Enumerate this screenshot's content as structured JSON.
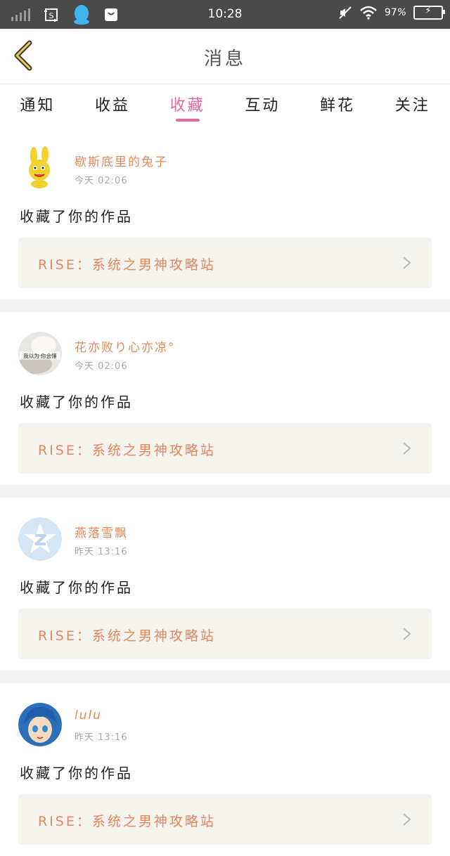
{
  "status_bar": {
    "time": "10:28",
    "battery": "97",
    "icons": [
      "signal-icon",
      "screenshot-icon",
      "qq-icon",
      "shopping-bag-icon",
      "mute-icon",
      "wifi-icon",
      "battery-icon"
    ]
  },
  "header": {
    "title": "消息",
    "back_icon": "chevron-left-icon"
  },
  "tabs": [
    {
      "label": "通知",
      "active": false
    },
    {
      "label": "收益",
      "active": false
    },
    {
      "label": "收藏",
      "active": true
    },
    {
      "label": "互动",
      "active": false
    },
    {
      "label": "鲜花",
      "active": false
    },
    {
      "label": "关注",
      "active": false
    }
  ],
  "colors": {
    "accent_pink": "#e46aa0",
    "name_orange": "#e48a5a",
    "work_bg": "#f4f3ee"
  },
  "messages": [
    {
      "user": "歇斯底里的兔子",
      "time": "今天 02:06",
      "action": "收藏了你的作品",
      "work": "RISE：系统之男神攻略站",
      "avatar": "bunny-avatar"
    },
    {
      "user": "花亦败り心亦凉°",
      "time": "今天 02:06",
      "action": "收藏了你的作品",
      "work": "RISE：系统之男神攻略站",
      "avatar": "photo-avatar",
      "avatar_text": "我以为·你会懂"
    },
    {
      "user": "燕落雪飘",
      "time": "昨天 13:16",
      "action": "收藏了你的作品",
      "work": "RISE：系统之男神攻略站",
      "avatar": "default-qq-avatar"
    },
    {
      "user": "lulu",
      "time": "昨天 13:16",
      "action": "收藏了你的作品",
      "work": "RISE：系统之男神攻略站",
      "avatar": "anime-avatar"
    }
  ]
}
